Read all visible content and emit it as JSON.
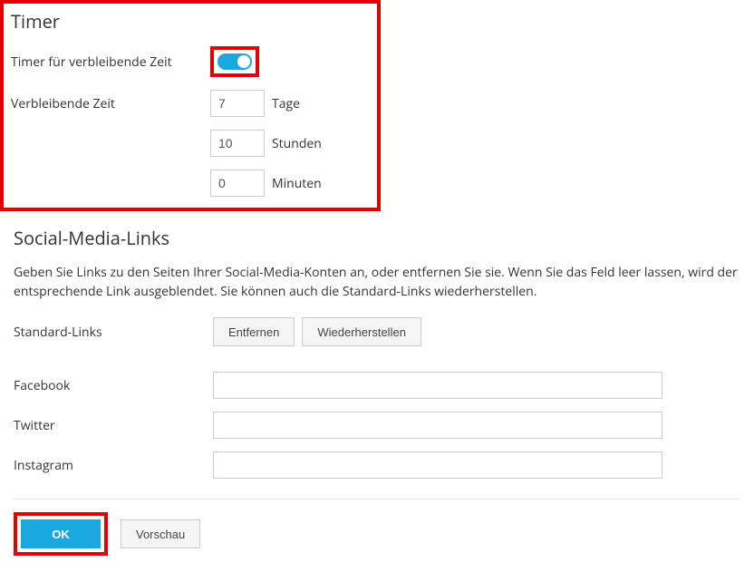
{
  "timer": {
    "heading": "Timer",
    "toggle_label": "Timer für verbleibende Zeit",
    "toggle_on": true,
    "remaining_label": "Verbleibende Zeit",
    "days_value": "7",
    "days_unit": "Tage",
    "hours_value": "10",
    "hours_unit": "Stunden",
    "minutes_value": "0",
    "minutes_unit": "Minuten"
  },
  "social": {
    "heading": "Social-Media-Links",
    "description": "Geben Sie Links zu den Seiten Ihrer Social-Media-Konten an, oder entfernen Sie sie. Wenn Sie das Feld leer lassen, wird der entsprechende Link ausgeblendet. Sie können auch die Standard-Links wiederherstellen.",
    "default_links_label": "Standard-Links",
    "remove_btn": "Entfernen",
    "restore_btn": "Wiederherstellen",
    "facebook_label": "Facebook",
    "facebook_value": "",
    "twitter_label": "Twitter",
    "twitter_value": "",
    "instagram_label": "Instagram",
    "instagram_value": ""
  },
  "footer": {
    "ok": "OK",
    "preview": "Vorschau"
  }
}
